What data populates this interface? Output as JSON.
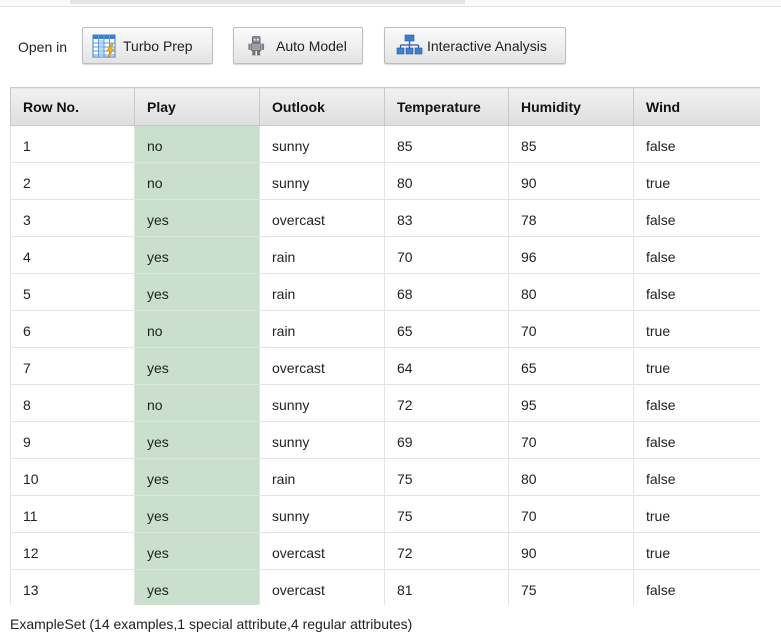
{
  "toolbar": {
    "open_in_label": "Open in",
    "buttons": [
      {
        "label": "Turbo Prep",
        "icon": "turbo-prep-grid-icon"
      },
      {
        "label": "Auto Model",
        "icon": "robot-icon"
      },
      {
        "label": "Interactive Analysis",
        "icon": "hierarchy-icon"
      }
    ]
  },
  "table": {
    "columns": [
      "Row No.",
      "Play",
      "Outlook",
      "Temperature",
      "Humidity",
      "Wind"
    ],
    "rows": [
      [
        "1",
        "no",
        "sunny",
        "85",
        "85",
        "false"
      ],
      [
        "2",
        "no",
        "sunny",
        "80",
        "90",
        "true"
      ],
      [
        "3",
        "yes",
        "overcast",
        "83",
        "78",
        "false"
      ],
      [
        "4",
        "yes",
        "rain",
        "70",
        "96",
        "false"
      ],
      [
        "5",
        "yes",
        "rain",
        "68",
        "80",
        "false"
      ],
      [
        "6",
        "no",
        "rain",
        "65",
        "70",
        "true"
      ],
      [
        "7",
        "yes",
        "overcast",
        "64",
        "65",
        "true"
      ],
      [
        "8",
        "no",
        "sunny",
        "72",
        "95",
        "false"
      ],
      [
        "9",
        "yes",
        "sunny",
        "69",
        "70",
        "false"
      ],
      [
        "10",
        "yes",
        "rain",
        "75",
        "80",
        "false"
      ],
      [
        "11",
        "yes",
        "sunny",
        "75",
        "70",
        "true"
      ],
      [
        "12",
        "yes",
        "overcast",
        "72",
        "90",
        "true"
      ],
      [
        "13",
        "yes",
        "overcast",
        "81",
        "75",
        "false"
      ]
    ],
    "special_column_color": "#cadfcd"
  },
  "status": {
    "summary": "ExampleSet (14 examples,1 special attribute,4 regular attributes)"
  }
}
